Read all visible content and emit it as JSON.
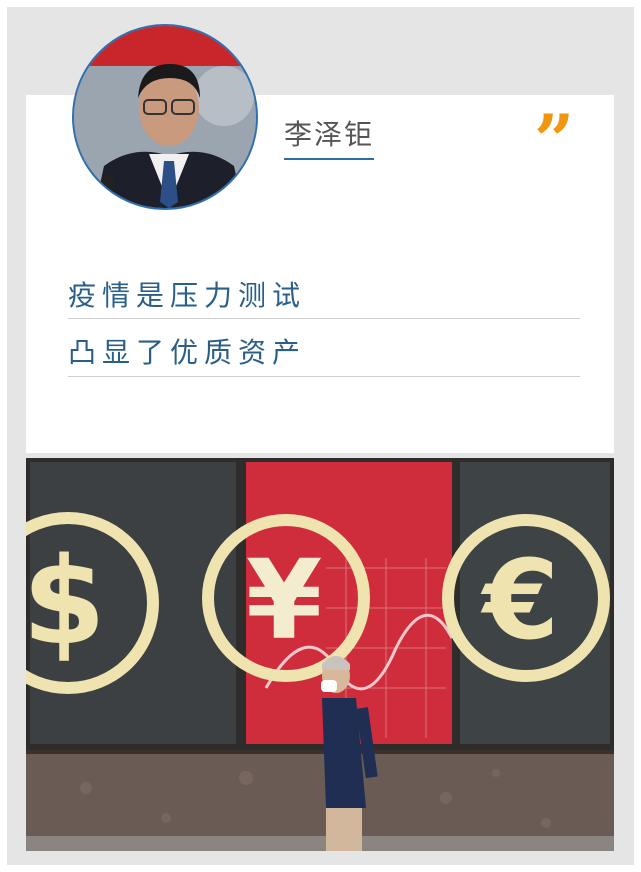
{
  "author": {
    "name": "李泽钜"
  },
  "quote_mark": "”",
  "headline": {
    "line1": "疫情是压力测试",
    "line2": "凸显了优质资产"
  },
  "photo": {
    "currency_symbols": [
      "$",
      "¥",
      "€"
    ]
  },
  "colors": {
    "accent": "#f0960f",
    "headline": "#2a5f88",
    "underline": "#2f6fa0"
  }
}
